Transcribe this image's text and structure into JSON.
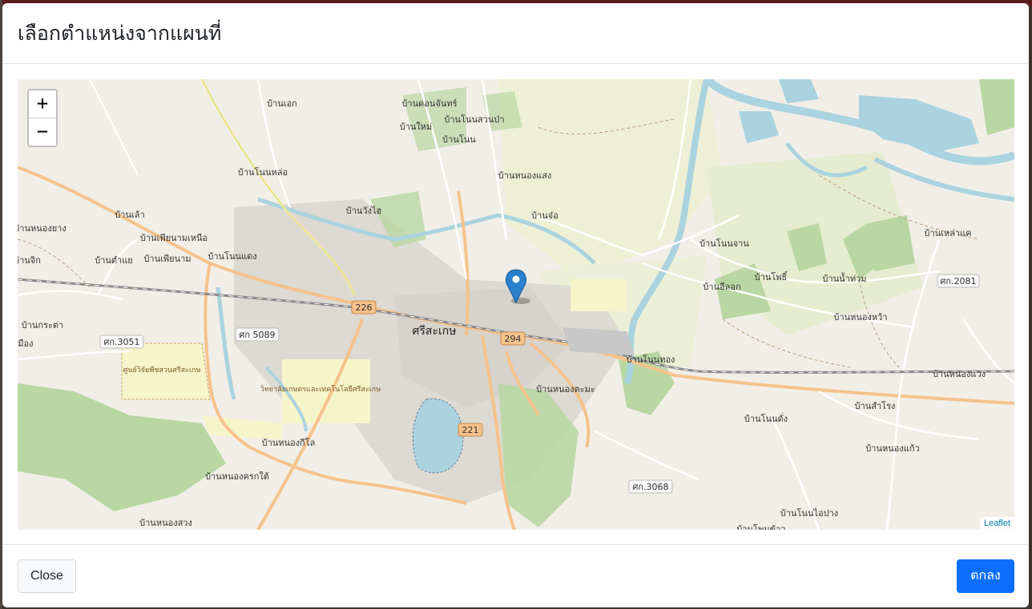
{
  "modal": {
    "title": "เลือกตำแหน่งจากแผนที่",
    "close_label": "Close",
    "ok_label": "ตกลง"
  },
  "map": {
    "zoom_in": "+",
    "zoom_out": "−",
    "attribution": "Leaflet",
    "places": [
      "บ้านเอก",
      "บ้านดอนจันทร์",
      "บ้านโนนสวนป่า",
      "บ้านใหม่",
      "บ้านโนน",
      "บ้านโนนหล่อ",
      "บ้านหนองแสง",
      "บ้านวังไฮ",
      "บ้านจ๋อ",
      "บ้านเล้า",
      "บ้านหนองยาง",
      "บ้านเพียนามเหนือ",
      "บ้านโนนจาน",
      "บ้านเหล่าแค",
      "บ้านจิก",
      "บ้านตำแย",
      "บ้านเพียนาม",
      "บ้านโนนแดง",
      "บ้านโพธิ์",
      "บ้านน้ำท่วม",
      "ศก.2081",
      "บ้านอีลอก",
      "บ้านกระต่า",
      "ศรีสะเกษ",
      "บ้านหนองหว้า",
      "เมือง",
      "ศก.3051",
      "ศก 5089",
      "บ้านโนนทอง",
      "บ้านหนองแวง",
      "ศูนย์วิจัยพืชสวนศรีสะเกษ",
      "วิทยาลัยเกษตรและเทคโนโลยีศรีสะเกษ",
      "บ้านหนองตะมะ",
      "บ้านสำโรง",
      "บ้านโนนดั่ง",
      "บ้านหนองกีโล",
      "บ้านหนองแก้ว",
      "บ้านหนองครกใต้",
      "ศก.3068",
      "บ้านโนนไอปาง",
      "บ้านหนองสวง",
      "บ้านโพนข้าว",
      "226",
      "294",
      "221"
    ]
  }
}
